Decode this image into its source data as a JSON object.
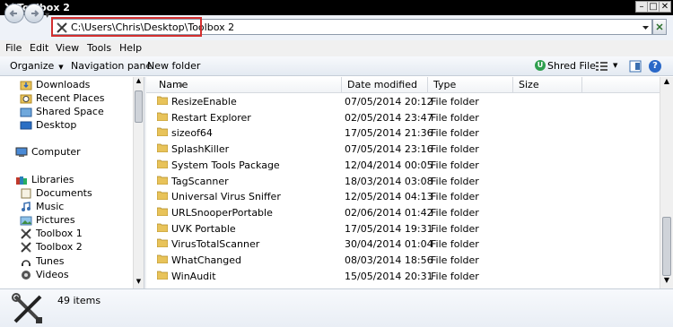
{
  "window": {
    "title": "Toolbox 2"
  },
  "address": {
    "path": "C:\\Users\\Chris\\Desktop\\Toolbox 2"
  },
  "menu": [
    "File",
    "Edit",
    "View",
    "Tools",
    "Help"
  ],
  "toolbar": {
    "organize": "Organize",
    "navigation_pane": "Navigation pane",
    "new_folder": "New folder",
    "shred_file": "Shred File"
  },
  "nav": [
    {
      "label": "Downloads",
      "icon": "downloads-icon"
    },
    {
      "label": "Recent Places",
      "icon": "recent-places-icon"
    },
    {
      "label": "Shared Space",
      "icon": "shared-space-icon"
    },
    {
      "label": "Desktop",
      "icon": "desktop-icon"
    },
    {
      "label": "Computer",
      "icon": "computer-icon"
    },
    {
      "label": "Libraries",
      "icon": "libraries-icon"
    },
    {
      "label": "Documents",
      "icon": "documents-icon"
    },
    {
      "label": "Music",
      "icon": "music-icon"
    },
    {
      "label": "Pictures",
      "icon": "pictures-icon"
    },
    {
      "label": "Toolbox 1",
      "icon": "toolbox-icon"
    },
    {
      "label": "Toolbox 2",
      "icon": "toolbox-icon"
    },
    {
      "label": "Tunes",
      "icon": "tunes-icon"
    },
    {
      "label": "Videos",
      "icon": "videos-icon"
    }
  ],
  "columns": {
    "name": "Name",
    "date": "Date modified",
    "type": "Type",
    "size": "Size"
  },
  "files": [
    {
      "name": "ResizeEnable",
      "date": "07/05/2014 20:12",
      "type": "File folder"
    },
    {
      "name": "Restart Explorer",
      "date": "02/05/2014 23:47",
      "type": "File folder"
    },
    {
      "name": "sizeof64",
      "date": "17/05/2014 21:36",
      "type": "File folder"
    },
    {
      "name": "SplashKiller",
      "date": "07/05/2014 23:16",
      "type": "File folder"
    },
    {
      "name": "System Tools Package",
      "date": "12/04/2014 00:05",
      "type": "File folder"
    },
    {
      "name": "TagScanner",
      "date": "18/03/2014 03:08",
      "type": "File folder"
    },
    {
      "name": "Universal Virus Sniffer",
      "date": "12/05/2014 04:13",
      "type": "File folder"
    },
    {
      "name": "URLSnooperPortable",
      "date": "02/06/2014 01:42",
      "type": "File folder"
    },
    {
      "name": "UVK Portable",
      "date": "17/05/2014 19:31",
      "type": "File folder"
    },
    {
      "name": "VirusTotalScanner",
      "date": "30/04/2014 01:04",
      "type": "File folder"
    },
    {
      "name": "WhatChanged",
      "date": "08/03/2014 18:56",
      "type": "File folder"
    },
    {
      "name": "WinAudit",
      "date": "15/05/2014 20:31",
      "type": "File folder"
    }
  ],
  "details": {
    "count": "49 items"
  }
}
